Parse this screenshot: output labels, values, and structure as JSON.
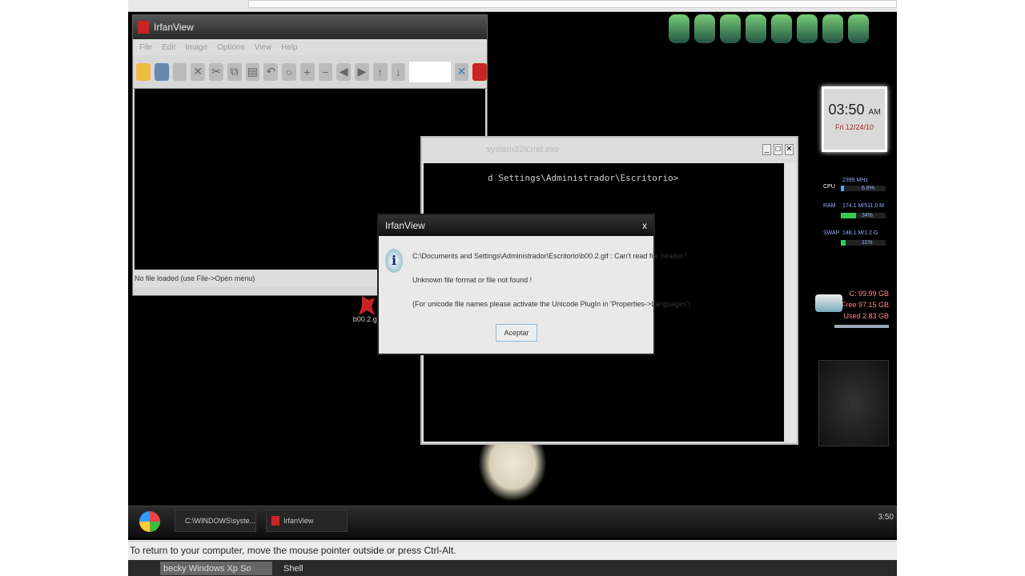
{
  "irfanview": {
    "title": "IrfanView",
    "menu": [
      "File",
      "Edit",
      "Image",
      "Options",
      "View",
      "Help"
    ],
    "status": "No file loaded (use File->Open menu)"
  },
  "cmd": {
    "title": "system32\\cmd.exe",
    "line": "d Settings\\Administrador\\Escritorio>"
  },
  "dialog": {
    "title": "IrfanView",
    "close": "x",
    "line1": "C:\\Documents and Settings\\Administrador\\Escritorio\\b00.2.gif : Can't read file header !",
    "line2": "Unknown file format or file not found !",
    "line3": "(For unicode file names please activate the Unicode PlugIn in 'Properties->Languages')",
    "ok": "Aceptar"
  },
  "desktop_file": {
    "label": "b00.2.gif"
  },
  "clock": {
    "time": "03:50",
    "ampm": "AM",
    "date": "Fri 12/24/10"
  },
  "sysmon": {
    "cpu_label": "CPU",
    "cpu": "2399 MHz",
    "cpu_pct": "6.8%",
    "cpu_fill": 6.8,
    "ram_label": "RAM",
    "ram": "174.1 M/511.0 M",
    "ram_pct": "34%",
    "ram_fill": 34,
    "swap_label": "SWAP",
    "swap": "148.1 M/1.2 G",
    "swap_pct": "11%",
    "swap_fill": 11
  },
  "disk": {
    "drive": "C: 99.99 GB",
    "free": "Free 97.15 GB",
    "used": "Used 2.83 GB"
  },
  "taskbar": {
    "items": [
      "C:\\WINDOWS\\syste...",
      "IrfanView"
    ],
    "time": "3:50"
  },
  "host": {
    "status": "To return to your computer, move the mouse pointer outside or press Ctrl-Alt.",
    "tasks": [
      "becky Windows Xp So",
      "Shell"
    ]
  }
}
